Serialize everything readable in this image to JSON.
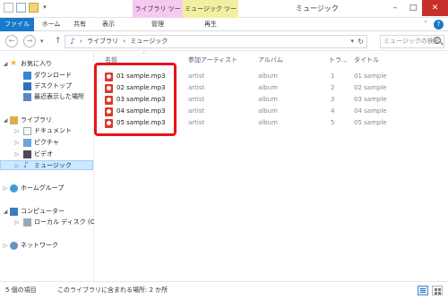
{
  "window": {
    "title": "ミュージック",
    "context_tab_library": "ライブラリ ツール",
    "context_tab_music": "ミュージック ツール"
  },
  "ribbon": {
    "tabs": [
      {
        "label": "ファイル"
      },
      {
        "label": "ホーム"
      },
      {
        "label": "共有"
      },
      {
        "label": "表示"
      },
      {
        "label": "管理"
      },
      {
        "label": "再生"
      }
    ]
  },
  "address": {
    "crumbs": [
      "ライブラリ",
      "ミュージック"
    ],
    "search_placeholder": "ミュージックの検索"
  },
  "nav": {
    "favorites": {
      "label": "お気に入り",
      "items": [
        {
          "label": "ダウンロード",
          "icon": "download-icon"
        },
        {
          "label": "デスクトップ",
          "icon": "desktop-icon"
        },
        {
          "label": "最近表示した場所",
          "icon": "recent-places-icon"
        }
      ]
    },
    "libraries": {
      "label": "ライブラリ",
      "items": [
        {
          "label": "ドキュメント",
          "icon": "documents-icon"
        },
        {
          "label": "ピクチャ",
          "icon": "pictures-icon"
        },
        {
          "label": "ビデオ",
          "icon": "videos-icon"
        },
        {
          "label": "ミュージック",
          "icon": "music-icon",
          "selected": true
        }
      ]
    },
    "homegroup": {
      "label": "ホームグループ"
    },
    "computer": {
      "label": "コンピューター",
      "items": [
        {
          "label": "ローカル ディスク (C:)",
          "icon": "local-disk-icon"
        }
      ]
    },
    "network": {
      "label": "ネットワーク"
    }
  },
  "columns": {
    "name": "名前",
    "artist": "参加アーティスト",
    "album": "アルバム",
    "track": "トラ...",
    "title": "タイトル"
  },
  "files": [
    {
      "name": "01 sample.mp3",
      "artist": "artist",
      "album": "album",
      "track": "1",
      "title": "01 sample"
    },
    {
      "name": "02 sample.mp3",
      "artist": "artist",
      "album": "album",
      "track": "2",
      "title": "02 sample"
    },
    {
      "name": "03 sample.mp3",
      "artist": "artist",
      "album": "album",
      "track": "3",
      "title": "03 sample"
    },
    {
      "name": "04 sample.mp3",
      "artist": "artist",
      "album": "album",
      "track": "4",
      "title": "04 sample"
    },
    {
      "name": "05 sample.mp3",
      "artist": "artist",
      "album": "album",
      "track": "5",
      "title": "05 sample"
    }
  ],
  "status": {
    "item_count": "5 個の項目",
    "location": "このライブラリに含まれる場所: 2 か所"
  },
  "colors": {
    "accent": "#1979ca",
    "highlight": "#e8141c",
    "close": "#c7302a"
  }
}
